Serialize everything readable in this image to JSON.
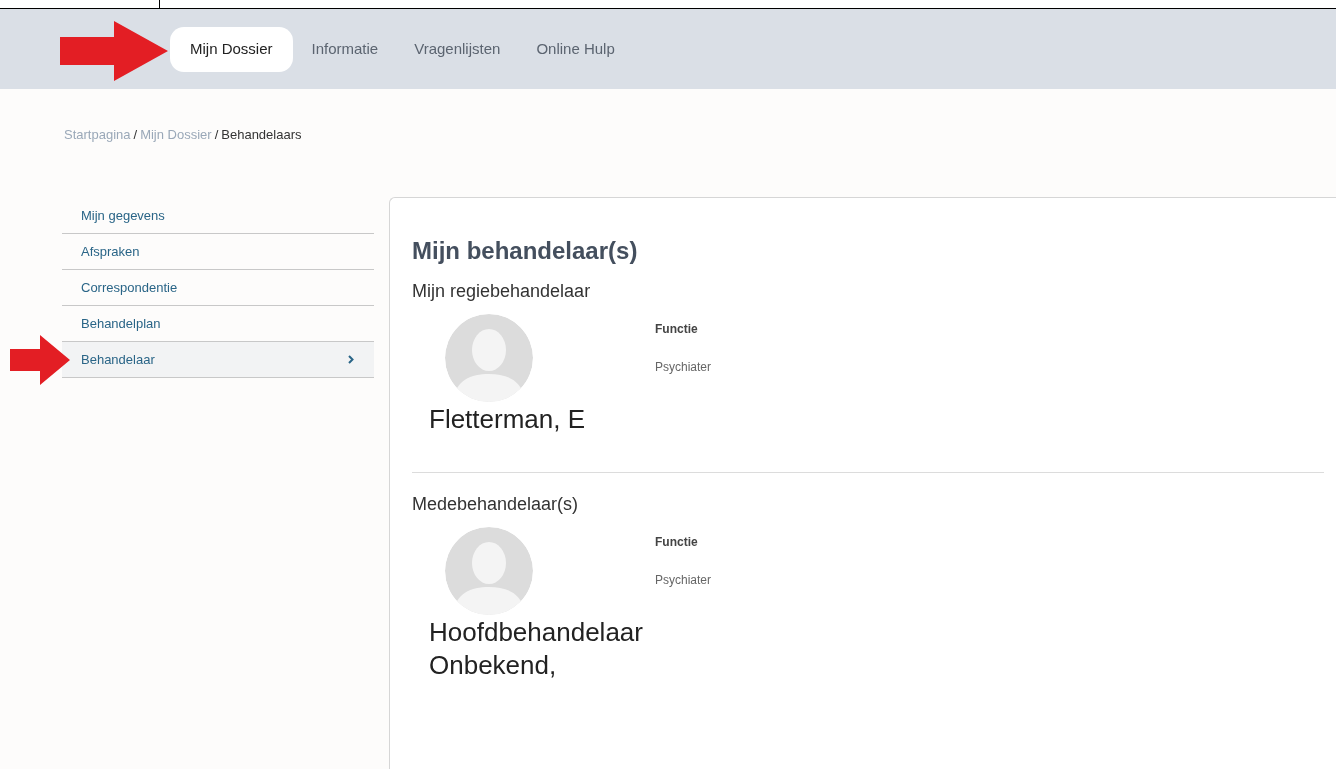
{
  "nav": {
    "tabs": [
      {
        "label": "Mijn Dossier",
        "selected": true
      },
      {
        "label": "Informatie",
        "selected": false
      },
      {
        "label": "Vragenlijsten",
        "selected": false
      },
      {
        "label": "Online Hulp",
        "selected": false
      }
    ]
  },
  "breadcrumb": [
    {
      "kind": "link",
      "label": "Startpagina"
    },
    {
      "kind": "separator",
      "label": "/"
    },
    {
      "kind": "link",
      "label": "Mijn Dossier"
    },
    {
      "kind": "separator",
      "label": "/"
    },
    {
      "kind": "current",
      "label": "Behandelaars"
    }
  ],
  "sidebar": {
    "items": [
      {
        "label": "Mijn gegevens",
        "selected": false
      },
      {
        "label": "Afspraken",
        "selected": false
      },
      {
        "label": "Correspondentie",
        "selected": false
      },
      {
        "label": "Behandelplan",
        "selected": false
      },
      {
        "label": "Behandelaar",
        "selected": true
      }
    ]
  },
  "main": {
    "title": "Mijn behandelaar(s)",
    "sections": [
      {
        "title": "Mijn regiebehandelaar",
        "people": [
          {
            "name": "Fletterman, E",
            "field_label": "Functie",
            "field_value": "Psychiater"
          }
        ]
      },
      {
        "title": "Medebehandelaar(s)",
        "people": [
          {
            "name": "Hoofdbehandelaar Onbekend,",
            "field_label": "Functie",
            "field_value": "Psychiater"
          }
        ]
      }
    ]
  }
}
